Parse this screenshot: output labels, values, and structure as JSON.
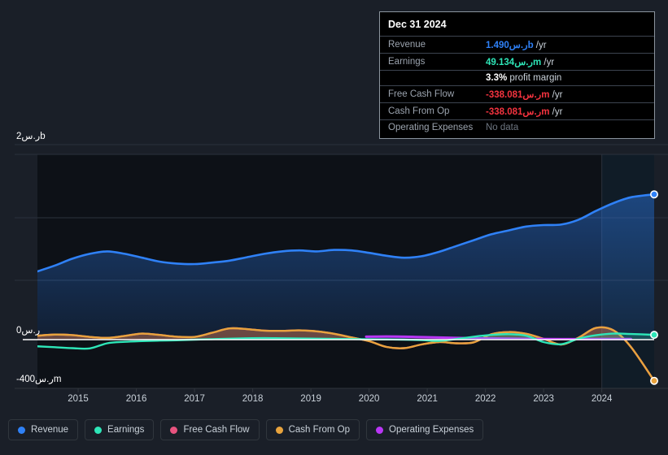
{
  "theme": {
    "page_bg": "#1a1f28",
    "plot_bg": "#0d1117",
    "grid": "#30363d",
    "zero_line": "#ffffff"
  },
  "tooltip": {
    "date": "Dec 31 2024",
    "rows": [
      {
        "label": "Revenue",
        "value": "1.490ر.سb",
        "suffix": " /yr",
        "color_class": "tt-blue"
      },
      {
        "label": "Earnings",
        "value": "49.134ر.سm",
        "suffix": " /yr",
        "color_class": "tt-green"
      },
      {
        "label": "",
        "value": "3.3%",
        "suffix": " profit margin",
        "color_class": "tt-white"
      },
      {
        "label": "Free Cash Flow",
        "value": "-338.081ر.سm",
        "suffix": " /yr",
        "color_class": "tt-red"
      },
      {
        "label": "Cash From Op",
        "value": "-338.081ر.سm",
        "suffix": " /yr",
        "color_class": "tt-red"
      },
      {
        "label": "Operating Expenses",
        "value": "No data",
        "suffix": "",
        "color_class": "tt-nodata"
      }
    ]
  },
  "legend": {
    "items": [
      {
        "label": "Revenue",
        "color": "#2f81f7"
      },
      {
        "label": "Earnings",
        "color": "#2ee6b8"
      },
      {
        "label": "Free Cash Flow",
        "color": "#e8537f"
      },
      {
        "label": "Cash From Op",
        "color": "#e8a33d"
      },
      {
        "label": "Operating Expenses",
        "color": "#b936f5"
      }
    ]
  },
  "chart_data": {
    "type": "area",
    "title": "",
    "xlabel": "",
    "ylabel": "",
    "currency": "ر.س",
    "y_axis": {
      "labels": [
        "2ر.سb",
        "0ر.س",
        "-400ر.سm"
      ],
      "top_value": 2000,
      "zero_value": 0,
      "bottom_value": -400,
      "unit": "millions",
      "gridlines": [
        2000,
        1350,
        740,
        0
      ]
    },
    "x_axis": {
      "tick_labels": [
        "2015",
        "2016",
        "2017",
        "2018",
        "2019",
        "2020",
        "2021",
        "2022",
        "2023",
        "2024"
      ],
      "start": 2014.3,
      "end": 2024.9
    },
    "legend_position": "bottom-left",
    "grid": true,
    "series": [
      {
        "name": "Revenue",
        "color": "#2f81f7",
        "fill": "rgba(47,129,247,0.20)",
        "x": [
          2014.3,
          2014.6,
          2014.9,
          2015.2,
          2015.5,
          2015.8,
          2016.1,
          2016.4,
          2016.7,
          2017.0,
          2017.3,
          2017.6,
          2017.9,
          2018.2,
          2018.5,
          2018.8,
          2019.1,
          2019.4,
          2019.7,
          2020.0,
          2020.3,
          2020.6,
          2020.9,
          2021.2,
          2021.5,
          2021.8,
          2022.1,
          2022.4,
          2022.7,
          2023.0,
          2023.3,
          2023.6,
          2023.9,
          2024.2,
          2024.5,
          2024.9
        ],
        "values": [
          700,
          760,
          830,
          880,
          905,
          880,
          840,
          800,
          780,
          775,
          790,
          810,
          845,
          880,
          905,
          915,
          905,
          920,
          915,
          890,
          860,
          840,
          855,
          900,
          960,
          1020,
          1080,
          1120,
          1160,
          1175,
          1180,
          1230,
          1320,
          1400,
          1460,
          1490
        ]
      },
      {
        "name": "Earnings",
        "color": "#2ee6b8",
        "fill": "rgba(46,230,184,0.22)",
        "x": [
          2014.3,
          2014.6,
          2014.9,
          2015.2,
          2015.5,
          2015.8,
          2016.1,
          2016.4,
          2016.7,
          2017.0,
          2017.3,
          2017.6,
          2017.9,
          2018.2,
          2018.5,
          2018.8,
          2019.1,
          2019.4,
          2019.7,
          2020.0,
          2020.3,
          2020.6,
          2020.9,
          2021.2,
          2021.5,
          2021.8,
          2022.1,
          2022.4,
          2022.7,
          2023.0,
          2023.3,
          2023.6,
          2023.9,
          2024.2,
          2024.5,
          2024.9
        ],
        "values": [
          -55,
          -62,
          -70,
          -72,
          -30,
          -18,
          -12,
          -8,
          -5,
          0,
          5,
          10,
          14,
          16,
          14,
          12,
          10,
          8,
          6,
          4,
          2,
          0,
          -4,
          -10,
          6,
          30,
          48,
          56,
          40,
          -20,
          -38,
          10,
          45,
          62,
          58,
          49
        ]
      },
      {
        "name": "Free Cash Flow",
        "color": "#e8537f",
        "fill": "rgba(232,83,127,0.22)",
        "x": [
          2014.3,
          2014.6,
          2014.9,
          2015.2,
          2015.5,
          2015.8,
          2016.1,
          2016.4,
          2016.7,
          2017.0,
          2017.3,
          2017.6,
          2017.9,
          2018.2,
          2018.5,
          2018.8,
          2019.1,
          2019.4,
          2019.7,
          2020.0,
          2020.3,
          2020.6,
          2020.9,
          2021.2,
          2021.5,
          2021.8,
          2022.1,
          2022.4,
          2022.7,
          2023.0,
          2023.3,
          2023.6,
          2023.9,
          2024.2,
          2024.5,
          2024.9
        ],
        "values": [
          40,
          52,
          46,
          28,
          18,
          38,
          62,
          48,
          30,
          28,
          70,
          115,
          108,
          92,
          90,
          95,
          85,
          60,
          22,
          -12,
          -60,
          -70,
          -40,
          -20,
          -30,
          -22,
          55,
          78,
          60,
          8,
          -40,
          20,
          120,
          95,
          -60,
          -338
        ]
      },
      {
        "name": "Cash From Op",
        "color": "#e8a33d",
        "fill": "rgba(232,163,61,0.25)",
        "x": [
          2014.3,
          2014.6,
          2014.9,
          2015.2,
          2015.5,
          2015.8,
          2016.1,
          2016.4,
          2016.7,
          2017.0,
          2017.3,
          2017.6,
          2017.9,
          2018.2,
          2018.5,
          2018.8,
          2019.1,
          2019.4,
          2019.7,
          2020.0,
          2020.3,
          2020.6,
          2020.9,
          2021.2,
          2021.5,
          2021.8,
          2022.1,
          2022.4,
          2022.7,
          2023.0,
          2023.3,
          2023.6,
          2023.9,
          2024.2,
          2024.5,
          2024.9
        ],
        "values": [
          40,
          52,
          46,
          28,
          18,
          38,
          62,
          48,
          30,
          28,
          70,
          115,
          108,
          92,
          90,
          95,
          85,
          60,
          22,
          -12,
          -60,
          -70,
          -40,
          -20,
          -30,
          -22,
          55,
          78,
          60,
          8,
          -40,
          20,
          120,
          95,
          -60,
          -338
        ]
      },
      {
        "name": "Operating Expenses",
        "color": "#b936f5",
        "fill": "rgba(185,54,245,0.22)",
        "x": [
          2019.95,
          2020.3,
          2020.6,
          2020.9,
          2021.2,
          2021.5,
          2021.8,
          2022.1,
          2022.4,
          2022.7,
          2023.0,
          2023.3,
          2023.6,
          2023.9,
          2024.2,
          2024.5
        ],
        "values": [
          30,
          32,
          30,
          26,
          22,
          18,
          14,
          12,
          10,
          8,
          6,
          5,
          5,
          6,
          6,
          6
        ]
      }
    ]
  }
}
